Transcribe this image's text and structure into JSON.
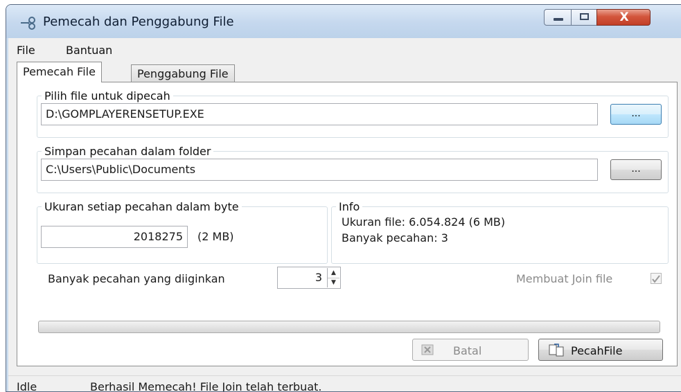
{
  "window": {
    "title": "Pemecah dan Penggabung File",
    "close_glyph": "X"
  },
  "menu": {
    "items": [
      "File",
      "Bantuan"
    ]
  },
  "tabs": [
    {
      "label": "Pemecah File",
      "active": true
    },
    {
      "label": "Penggabung File",
      "active": false
    }
  ],
  "split": {
    "source_group": "Pilih file untuk dipecah",
    "source_path": "D:\\GOMPLAYERENSETUP.EXE",
    "browse_label": "...",
    "dest_group": "Simpan pecahan dalam folder",
    "dest_path": "C:\\Users\\Public\\Documents",
    "size_group": "Ukuran setiap pecahan dalam byte",
    "size_value": "2018275",
    "size_human": "(2 MB)",
    "info_group": "Info",
    "info_size": "Ukuran file: 6.054.824 (6 MB)",
    "info_count": "Banyak pecahan: 3",
    "pieces_label": "Banyak pecahan yang diiginkan",
    "pieces_value": "3",
    "join_label": "Membuat Join file",
    "join_checked": true,
    "progress": 0,
    "cancel_label": "Batal",
    "split_label": "PecahFile"
  },
  "status": {
    "state": "Idle",
    "message": "Berhasil Memecah! File Join telah terbuat."
  },
  "icons": {
    "app": "scissors-icon",
    "cancel": "cancel-icon",
    "split": "split-file-icon",
    "checkbox": "checkmark-icon"
  }
}
